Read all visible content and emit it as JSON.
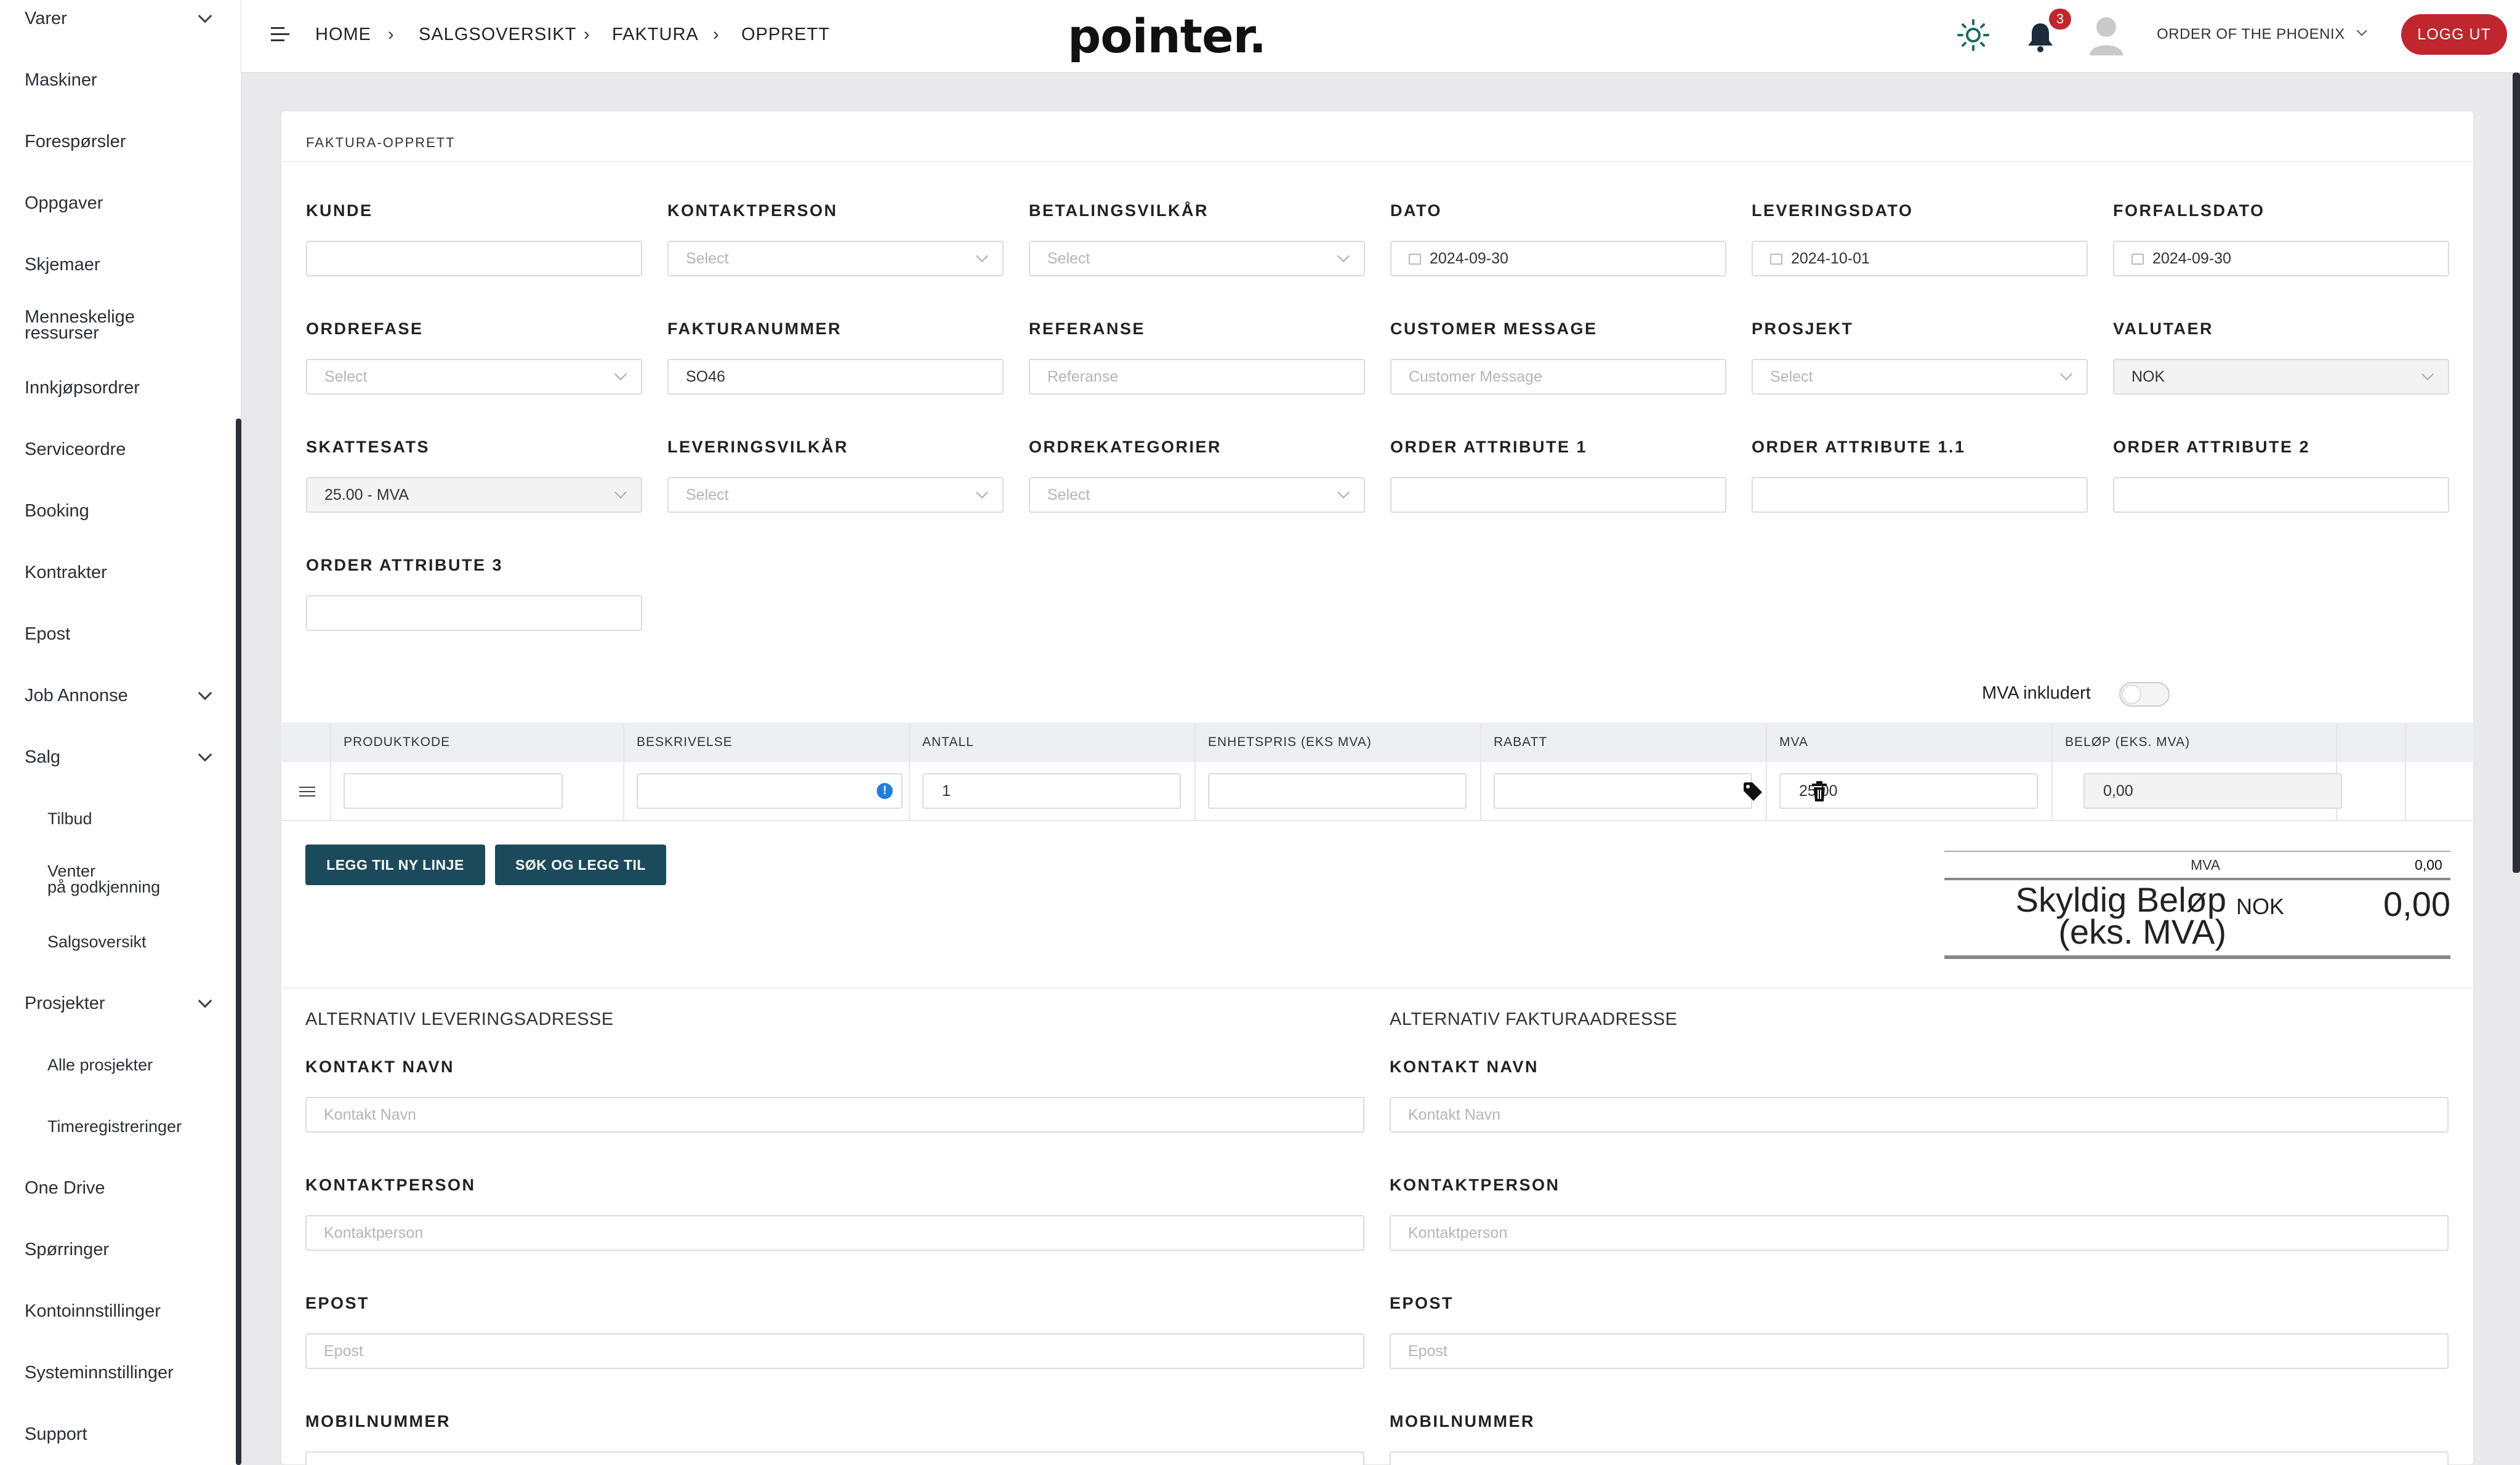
{
  "sidebar": {
    "items": [
      {
        "label": "Varer",
        "chevron": true
      },
      {
        "label": "Maskiner"
      },
      {
        "label": "Forespørsler"
      },
      {
        "label": "Oppgaver"
      },
      {
        "label": "Skjemaer"
      },
      {
        "label": "Menneskelige ressurser"
      },
      {
        "label": "Innkjøpsordrer"
      },
      {
        "label": "Serviceordre"
      },
      {
        "label": "Booking"
      },
      {
        "label": "Kontrakter"
      },
      {
        "label": "Epost"
      },
      {
        "label": "Job Annonse",
        "chevron": true
      },
      {
        "label": "Salg",
        "chevron": true
      },
      {
        "label": "Tilbud",
        "sub": true
      },
      {
        "label": "Venter på godkjenning",
        "sub": true
      },
      {
        "label": "Salgsoversikt",
        "sub": true
      },
      {
        "label": "Prosjekter",
        "chevron": true
      },
      {
        "label": "Alle prosjekter",
        "sub": true
      },
      {
        "label": "Timeregistreringer",
        "sub": true
      },
      {
        "label": "One Drive"
      },
      {
        "label": "Spørringer"
      },
      {
        "label": "Kontoinnstillinger"
      },
      {
        "label": "Systeminnstillinger"
      },
      {
        "label": "Support"
      }
    ],
    "item_label_line2_a": "Menneskelige",
    "item_label_line2_b": "ressurser",
    "item_venter_a": "Venter",
    "item_venter_b": "på godkjenning"
  },
  "header": {
    "breadcrumbs": [
      "HOME",
      "SALGSOVERSIKT",
      "FAKTURA",
      "OPPRETT"
    ],
    "logo": "pointer.",
    "notifications_count": "3",
    "org": "ORDER OF THE PHOENIX",
    "logout": "LOGG UT"
  },
  "card": {
    "title": "FAKTURA-OPPRETT",
    "fields": {
      "kunde": {
        "label": "KUNDE",
        "value": ""
      },
      "kontaktperson": {
        "label": "KONTAKTPERSON",
        "placeholder": "Select"
      },
      "betalingsvilkar": {
        "label": "BETALINGSVILKÅR",
        "placeholder": "Select"
      },
      "dato": {
        "label": "DATO",
        "value": "2024-09-30"
      },
      "leveringsdato": {
        "label": "LEVERINGSDATO",
        "value": "2024-10-01"
      },
      "forfallsdato": {
        "label": "FORFALLSDATO",
        "value": "2024-09-30"
      },
      "ordrefase": {
        "label": "ORDREFASE",
        "placeholder": "Select"
      },
      "fakturanummer": {
        "label": "FAKTURANUMMER",
        "value": "SO46"
      },
      "referanse": {
        "label": "REFERANSE",
        "placeholder": "Referanse"
      },
      "customer_message": {
        "label": "CUSTOMER MESSAGE",
        "placeholder": "Customer Message"
      },
      "prosjekt": {
        "label": "PROSJEKT",
        "placeholder": "Select"
      },
      "valutaer": {
        "label": "VALUTAER",
        "value": "NOK"
      },
      "skattesats": {
        "label": "SKATTESATS",
        "value": "25.00 - MVA"
      },
      "leveringsvilkar": {
        "label": "LEVERINGSVILKÅR",
        "placeholder": "Select"
      },
      "ordrekategorier": {
        "label": "ORDREKATEGORIER",
        "placeholder": "Select"
      },
      "order_attr_1": {
        "label": "ORDER ATTRIBUTE 1",
        "value": ""
      },
      "order_attr_11": {
        "label": "ORDER ATTRIBUTE 1.1",
        "value": ""
      },
      "order_attr_2": {
        "label": "ORDER ATTRIBUTE 2",
        "value": ""
      },
      "order_attr_3": {
        "label": "ORDER ATTRIBUTE 3",
        "value": ""
      }
    },
    "mva_inkludert": "MVA inkludert",
    "table": {
      "headers": [
        "PRODUKTKODE",
        "BESKRIVELSE",
        "ANTALL",
        "ENHETSPRIS (EKS MVA)",
        "RABATT",
        "MVA",
        "BELØP (EKS. MVA)"
      ],
      "row": {
        "produktkode": "",
        "beskrivelse": "",
        "antall": "1",
        "enhetspris": "",
        "rabatt": "",
        "mva": "25.00",
        "belop": "0,00"
      }
    },
    "buttons": {
      "add_line": "LEGG TIL NY LINJE",
      "search_add": "SØK OG LEGG TIL"
    },
    "totals": {
      "mva_label": "MVA",
      "mva_value": "0,00",
      "due_label_1": "Skyldig Beløp",
      "due_label_2": "(eks. MVA)",
      "currency": "NOK",
      "due_value": "0,00"
    },
    "delivery": {
      "title": "ALTERNATIV LEVERINGSADRESSE",
      "kontakt_navn": {
        "label": "KONTAKT NAVN",
        "placeholder": "Kontakt Navn"
      },
      "kontaktperson": {
        "label": "KONTAKTPERSON",
        "placeholder": "Kontaktperson"
      },
      "epost": {
        "label": "EPOST",
        "placeholder": "Epost"
      },
      "mobilnummer": {
        "label": "MOBILNUMMER"
      }
    },
    "invoice": {
      "title": "ALTERNATIV FAKTURAADRESSE",
      "kontakt_navn": {
        "label": "KONTAKT NAVN",
        "placeholder": "Kontakt Navn"
      },
      "kontaktperson": {
        "label": "KONTAKTPERSON",
        "placeholder": "Kontaktperson"
      },
      "epost": {
        "label": "EPOST",
        "placeholder": "Epost"
      },
      "mobilnummer": {
        "label": "MOBILNUMMER"
      }
    }
  },
  "colors": {
    "accent_red": "#c0262d",
    "button_teal": "#1a4a5c",
    "info_blue": "#1f7de0"
  }
}
